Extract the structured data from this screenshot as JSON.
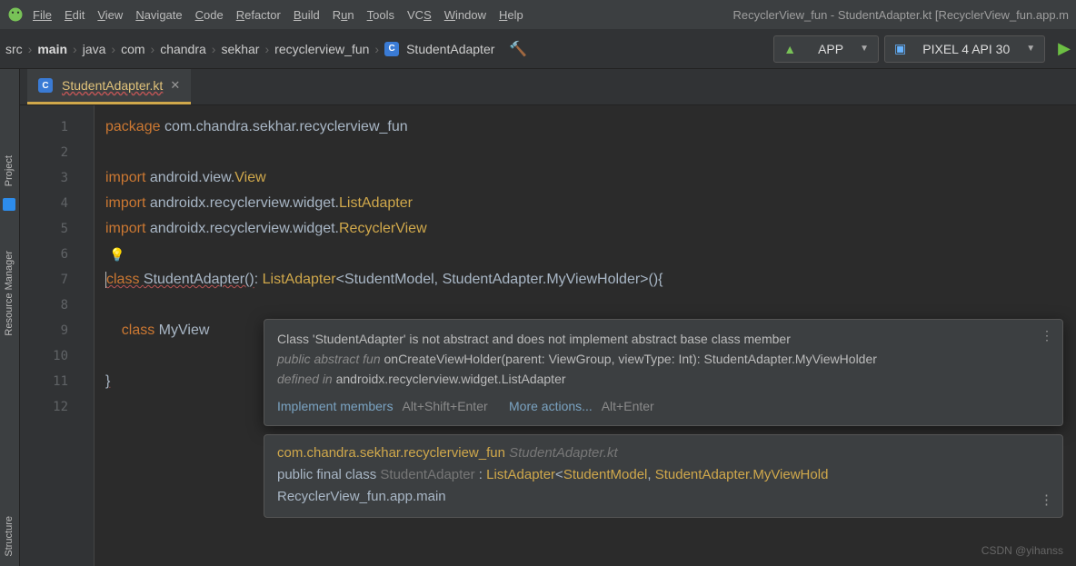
{
  "menu": {
    "items": [
      "File",
      "Edit",
      "View",
      "Navigate",
      "Code",
      "Refactor",
      "Build",
      "Run",
      "Tools",
      "VCS",
      "Window",
      "Help"
    ]
  },
  "window_title": "RecyclerView_fun - StudentAdapter.kt [RecyclerView_fun.app.m",
  "breadcrumbs": [
    "src",
    "main",
    "java",
    "com",
    "chandra",
    "sekhar",
    "recyclerview_fun",
    "StudentAdapter"
  ],
  "run_config": {
    "label": "APP"
  },
  "device": {
    "label": "PIXEL 4 API 30"
  },
  "tab": {
    "label": "StudentAdapter.kt"
  },
  "sidebar": {
    "project": "Project",
    "resmgr": "Resource Manager",
    "structure": "Structure"
  },
  "gutter_lines": [
    "1",
    "2",
    "3",
    "4",
    "5",
    "6",
    "7",
    "8",
    "9",
    "10",
    "11",
    "12"
  ],
  "code": {
    "l1": {
      "kw": "package",
      "pkg": "com.chandra.sekhar.recyclerview_fun"
    },
    "l3": {
      "kw": "import",
      "t1": "android.view.",
      "t2": "View"
    },
    "l4": {
      "kw": "import",
      "t1": "androidx.recyclerview.widget.",
      "t2": "ListAdapter"
    },
    "l5": {
      "kw": "import",
      "t1": "androidx.recyclerview.widget.",
      "t2": "RecyclerView"
    },
    "l7": {
      "a": "class ",
      "b": "StudentAdapter()",
      "c": ": ",
      "d": "ListAdapter",
      "e": "<",
      "f": "StudentModel",
      "g": ", ",
      "h": "StudentAdapter.MyViewHolder",
      "i": ">(){"
    },
    "l9": {
      "a": "class",
      "b": " MyView"
    },
    "l11": {
      "a": "}"
    }
  },
  "popup": {
    "msg1": "Class 'StudentAdapter' is not abstract and does not implement abstract base class member",
    "msg2a": "public abstract fun",
    "msg2b": " onCreateViewHolder(parent: ViewGroup, viewType: Int): StudentAdapter.MyViewHolder",
    "msg3a": "defined in",
    "msg3b": " androidx.recyclerview.widget.ListAdapter",
    "act1": "Implement members",
    "kb1": "Alt+Shift+Enter",
    "act2": "More actions...",
    "kb2": "Alt+Enter"
  },
  "popup2": {
    "l1a": "com.chandra.sekhar.recyclerview_fun",
    "l1b": " StudentAdapter.kt",
    "l2a": "public final class ",
    "l2b": "StudentAdapter",
    "l2c": " : ",
    "l2d": "ListAdapter",
    "l2e": "<",
    "l2f": "StudentModel",
    "l2g": ", ",
    "l2h": "StudentAdapter.MyViewHold",
    "l3": "  RecyclerView_fun.app.main"
  },
  "watermark": "CSDN @yihanss"
}
